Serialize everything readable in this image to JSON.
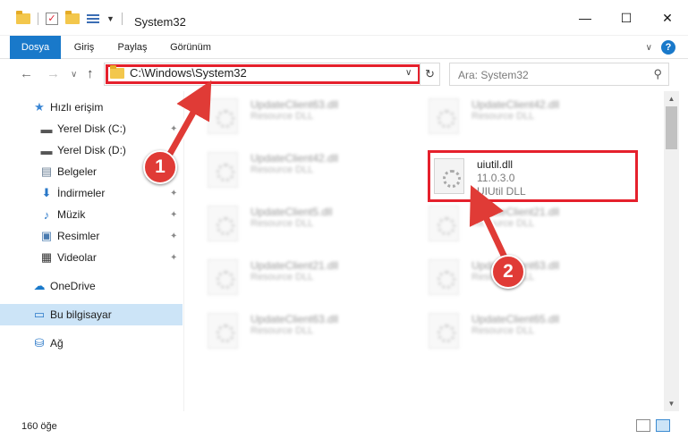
{
  "window": {
    "title": "System32",
    "minimize_glyph": "—",
    "maximize_glyph": "☐",
    "close_glyph": "✕"
  },
  "ribbon": {
    "tabs": [
      "Dosya",
      "Giriş",
      "Paylaş",
      "Görünüm"
    ],
    "collapse_glyph": "∨",
    "help_glyph": "?"
  },
  "address": {
    "path": "C:\\Windows\\System32",
    "dropdown_glyph": "∨",
    "refresh_glyph": "↻"
  },
  "search": {
    "placeholder": "Ara: System32",
    "icon": "search-icon"
  },
  "nav": {
    "back_glyph": "←",
    "forward_glyph": "→",
    "recent_glyph": "∨",
    "up_glyph": "↑"
  },
  "sidebar": {
    "items": [
      {
        "label": "Hızlı erişim",
        "icon": "star-icon",
        "pinned": false
      },
      {
        "label": "Yerel Disk (C:)",
        "icon": "drive-icon",
        "pinned": true
      },
      {
        "label": "Yerel Disk (D:)",
        "icon": "drive-icon",
        "pinned": true
      },
      {
        "label": "Belgeler",
        "icon": "documents-icon",
        "pinned": true
      },
      {
        "label": "İndirmeler",
        "icon": "download-icon",
        "pinned": true
      },
      {
        "label": "Müzik",
        "icon": "music-icon",
        "pinned": true
      },
      {
        "label": "Resimler",
        "icon": "pictures-icon",
        "pinned": true
      },
      {
        "label": "Videolar",
        "icon": "videos-icon",
        "pinned": true
      },
      {
        "label": "OneDrive",
        "icon": "cloud-icon",
        "pinned": false
      },
      {
        "label": "Bu bilgisayar",
        "icon": "computer-icon",
        "pinned": false
      },
      {
        "label": "Ağ",
        "icon": "network-icon",
        "pinned": false
      }
    ],
    "pin_glyph": "📌"
  },
  "files": {
    "left_column": [
      {
        "name": "UpdateClient63.dll",
        "type": "Resource DLL"
      },
      {
        "name": "UpdateClient42.dll",
        "type": "Resource DLL"
      },
      {
        "name": "UpdateClient5.dll",
        "type": "Resource DLL"
      },
      {
        "name": "UpdateClient21.dll",
        "type": "Resource DLL"
      },
      {
        "name": "UpdateClient63.dll",
        "type": "Resource DLL"
      }
    ],
    "right_column": [
      {
        "name": "UpdateClient42.dll",
        "type": "Resource DLL"
      },
      {
        "name": "UpdateClient21.dll",
        "type": "Resource DLL"
      },
      {
        "name": "UpdateClient63.dll",
        "type": "Resource DLL"
      },
      {
        "name": "UpdateClient65.dll",
        "type": "Resource DLL"
      }
    ],
    "highlighted": {
      "name": "uiutil.dll",
      "version": "11.0.3.0",
      "type": "UIUtil DLL"
    }
  },
  "status": {
    "item_count": "160 öğe"
  },
  "callouts": [
    "1",
    "2"
  ],
  "colors": {
    "accent": "#1979ca",
    "highlight_red": "#e5202c",
    "callout_red": "#e03b36",
    "selected_bg": "#cce4f7"
  }
}
